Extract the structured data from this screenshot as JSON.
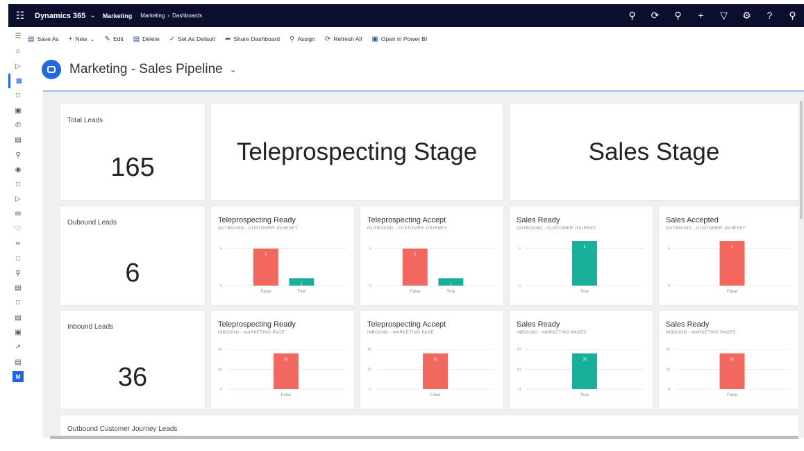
{
  "topbar": {
    "brand": "Dynamics 365",
    "area": "Marketing",
    "breadcrumb": [
      "Marketing",
      "Dashboards"
    ],
    "icons": [
      "waffle-icon",
      "search-icon",
      "recent-icon",
      "lightbulb-icon",
      "plus-icon",
      "filter-icon",
      "gear-icon",
      "help-icon",
      "user-icon"
    ]
  },
  "commandbar": {
    "items": [
      {
        "label": "Save As",
        "icon": "save-icon"
      },
      {
        "label": "New",
        "icon": "plus-icon"
      },
      {
        "label": "Edit",
        "icon": "pencil-icon"
      },
      {
        "label": "Delete",
        "icon": "trash-icon"
      },
      {
        "label": "Set As Default",
        "icon": "check-icon"
      },
      {
        "label": "Share Dashboard",
        "icon": "share-icon"
      },
      {
        "label": "Assign",
        "icon": "person-icon"
      },
      {
        "label": "Refresh All",
        "icon": "refresh-icon"
      },
      {
        "label": "Open in Power BI",
        "icon": "powerbi-icon"
      }
    ]
  },
  "rail": {
    "user_initial": "M"
  },
  "dashboard": {
    "title": "Marketing - Sales Pipeline",
    "kpis": [
      {
        "label": "Total Leads",
        "value": "165"
      },
      {
        "label": "Oubound Leads",
        "value": "6"
      },
      {
        "label": "Inbound Leads",
        "value": "36"
      }
    ],
    "stages": [
      "Teleprospecting Stage",
      "Sales Stage"
    ],
    "bottom_label": "Outbound Customer Journey Leads",
    "colors": {
      "false_bar": "#f2685e",
      "true_bar": "#1aaf9a"
    }
  },
  "chart_data": [
    {
      "type": "bar",
      "title": "Teleprospecting Ready",
      "subtitle": "OUTBOUND - CUSTOMER JOURNEY",
      "categories": [
        "False",
        "True"
      ],
      "values": [
        5,
        1
      ],
      "yticks": [
        0,
        5
      ],
      "ylim": [
        0,
        6
      ]
    },
    {
      "type": "bar",
      "title": "Teleprospecting Accept",
      "subtitle": "OUTBOUND - CUSTOMER JOURNEY",
      "categories": [
        "False",
        "True"
      ],
      "values": [
        5,
        1
      ],
      "yticks": [
        0,
        5
      ],
      "ylim": [
        0,
        6
      ]
    },
    {
      "type": "bar",
      "title": "Sales Ready",
      "subtitle": "OUTBOUND - CUSTOMER JOURNEY",
      "categories": [
        "True"
      ],
      "values": [
        6
      ],
      "yticks": [
        0,
        5
      ],
      "ylim": [
        0,
        6
      ]
    },
    {
      "type": "bar",
      "title": "Sales Accepted",
      "subtitle": "OUTBOUND - CUSTOMER JOURNEY",
      "categories": [
        "False"
      ],
      "values": [
        6
      ],
      "yticks": [
        0,
        5
      ],
      "ylim": [
        0,
        6
      ]
    },
    {
      "type": "bar",
      "title": "Teleprospecting Ready",
      "subtitle": "INBOUND - MARKETING PAGE",
      "categories": [
        "False"
      ],
      "values": [
        36
      ],
      "yticks": [
        0,
        20,
        40
      ],
      "ylim": [
        0,
        44
      ]
    },
    {
      "type": "bar",
      "title": "Teleprospecting Accept",
      "subtitle": "INBOUND - MARKETING PAGE",
      "categories": [
        "False"
      ],
      "values": [
        36
      ],
      "yticks": [
        0,
        20,
        40
      ],
      "ylim": [
        0,
        44
      ]
    },
    {
      "type": "bar",
      "title": "Sales Ready",
      "subtitle": "INBOUND - MARKETING PAGES",
      "categories": [
        "True"
      ],
      "values": [
        36
      ],
      "yticks": [
        0,
        20,
        40
      ],
      "ylim": [
        0,
        44
      ]
    },
    {
      "type": "bar",
      "title": "Sales Ready",
      "subtitle": "INBOUND - MARKETING PAGES",
      "categories": [
        "False"
      ],
      "values": [
        36
      ],
      "yticks": [
        0,
        20,
        40
      ],
      "ylim": [
        0,
        44
      ]
    }
  ]
}
